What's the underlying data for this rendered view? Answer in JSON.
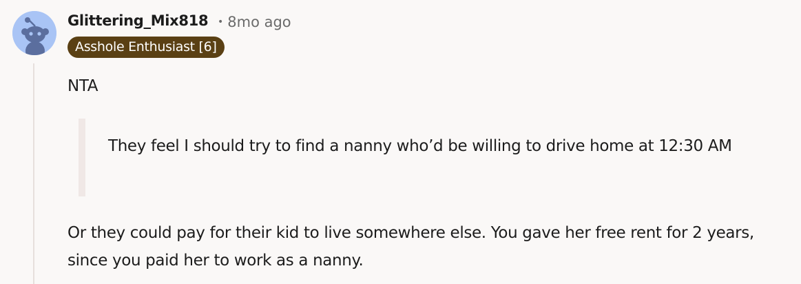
{
  "comment": {
    "author": "Glittering_Mix818",
    "separator": "•",
    "timestamp": "8mo ago",
    "flair": "Asshole Enthusiast [6]",
    "avatar_icon": "reddit-snoo-avatar-icon",
    "paragraphs": {
      "p1": "NTA",
      "quote": "They feel I should try to find a nanny who’d be willing to drive home at 12:30 AM",
      "p2": "Or they could pay for their kid to live somewhere else. You gave her free rent for 2 years, since you paid her to work as a nanny."
    }
  },
  "colors": {
    "background": "#faf8f7",
    "avatar_bg": "#a9c4f5",
    "avatar_figure": "#5b6e9e",
    "flair_bg": "#5a4014",
    "flair_text": "#ffffff",
    "meta_text": "#6b6b6b",
    "quote_bar": "#f0e8e6",
    "thread_line": "#e6dfdc"
  }
}
